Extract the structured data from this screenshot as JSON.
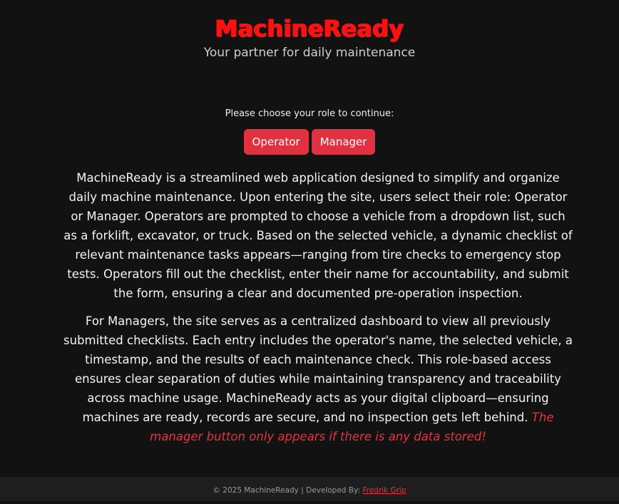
{
  "header": {
    "brand": "MachineReady",
    "tagline": "Your partner for daily maintenance"
  },
  "roles": {
    "prompt": "Please choose your role to continue:",
    "operator_label": "Operator",
    "manager_label": "Manager"
  },
  "content": {
    "paragraph_1": "MachineReady is a streamlined web application designed to simplify and organize daily machine maintenance. Upon entering the site, users select their role: Operator or Manager. Operators are prompted to choose a vehicle from a dropdown list, such as a forklift, excavator, or truck. Based on the selected vehicle, a dynamic checklist of relevant maintenance tasks appears—ranging from tire checks to emergency stop tests. Operators fill out the checklist, enter their name for accountability, and submit the form, ensuring a clear and documented pre-operation inspection.",
    "paragraph_2": "For Managers, the site serves as a centralized dashboard to view all previously submitted checklists. Each entry includes the operator's name, the selected vehicle, a timestamp, and the results of each maintenance check. This role-based access ensures clear separation of duties while maintaining transparency and traceability across machine usage. MachineReady acts as your digital clipboard—ensuring machines are ready, records are secure, and no inspection gets left behind.",
    "note": "The manager button only appears if there is any data stored!"
  },
  "footer": {
    "text": "© 2025 MachineReady | Developed By:",
    "developer": "Fredrik Grip"
  },
  "colors": {
    "background": "#121212",
    "brand_red": "#ff1010",
    "button_red": "#e03140",
    "footer_bg": "#1e1e1e"
  }
}
